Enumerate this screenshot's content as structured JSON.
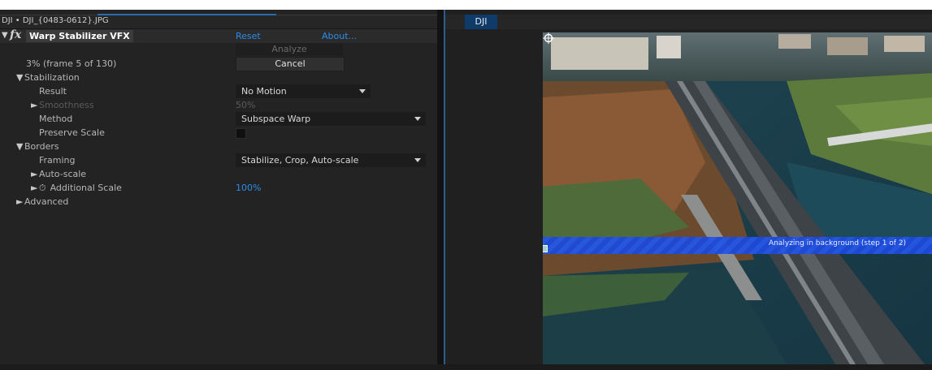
{
  "effect_panel": {
    "tab_title": "DJI • DJI_{0483-0612}.JPG",
    "effect_name": "Warp Stabilizer VFX",
    "fx_label": "fx",
    "reset_label": "Reset",
    "about_label": "About...",
    "analyze_label": "Analyze",
    "cancel_label": "Cancel",
    "progress_text": "3% (frame 5 of 130)",
    "stabilization": {
      "label": "Stabilization",
      "result_label": "Result",
      "result_value": "No Motion",
      "smoothness_label": "Smoothness",
      "smoothness_value": "50%",
      "method_label": "Method",
      "method_value": "Subspace Warp",
      "preserve_scale_label": "Preserve Scale",
      "preserve_scale_checked": false
    },
    "borders": {
      "label": "Borders",
      "framing_label": "Framing",
      "framing_value": "Stabilize, Crop, Auto-scale",
      "autoscale_label": "Auto-scale",
      "additional_scale_label": "Additional Scale",
      "additional_scale_value": "100%"
    },
    "advanced_label": "Advanced"
  },
  "viewer": {
    "tab_label": "DJI",
    "analysis_banner": "Analyzing in background (step 1 of 2)"
  },
  "colors": {
    "accent_blue": "#2d8ceb",
    "banner_blue": "#1f4fe0",
    "panel_bg": "#232323"
  }
}
